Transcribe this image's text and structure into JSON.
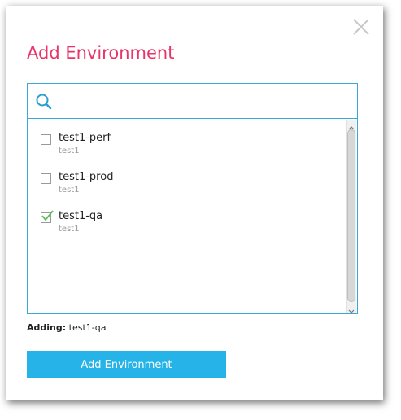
{
  "dialog": {
    "title": "Add Environment",
    "close_icon": "close-icon"
  },
  "search": {
    "icon": "search-icon",
    "value": "",
    "placeholder": ""
  },
  "environments": [
    {
      "name": "test1-perf",
      "sub": "test1",
      "checked": false
    },
    {
      "name": "test1-prod",
      "sub": "test1",
      "checked": false
    },
    {
      "name": "test1-qa",
      "sub": "test1",
      "checked": true
    }
  ],
  "adding": {
    "label": "Adding:",
    "value": "test1-qa"
  },
  "submit_label": "Add Environment",
  "colors": {
    "title": "#e8336b",
    "accent_border": "#3aa8d4",
    "button": "#26b3e8",
    "check": "#5cb85c"
  }
}
